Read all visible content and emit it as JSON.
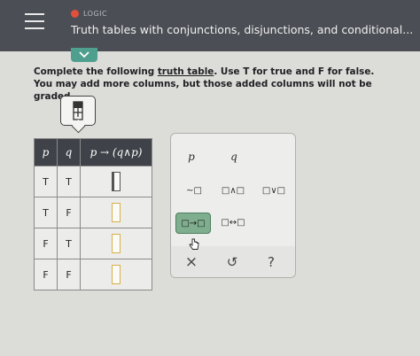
{
  "header": {
    "topic": "LOGIC",
    "title": "Truth tables with conjunctions, disjunctions, and conditional..."
  },
  "instructions": {
    "line1_before": "Complete the following ",
    "line1_link": "truth table",
    "line1_after": ". Use T for true and F for false.",
    "line2": "You may add more columns, but those added columns will not be graded."
  },
  "table": {
    "headers": [
      "p",
      "q",
      "p → (q∧p)"
    ],
    "rows": [
      {
        "p": "T",
        "q": "T"
      },
      {
        "p": "T",
        "q": "F"
      },
      {
        "p": "F",
        "q": "T"
      },
      {
        "p": "F",
        "q": "F"
      }
    ]
  },
  "palette": {
    "var_p": "p",
    "var_q": "q",
    "not": "~□",
    "and": "□∧□",
    "or": "□∨□",
    "implies": "□→□",
    "iff": "□↔□",
    "clear": "×",
    "undo": "↺",
    "help": "?"
  },
  "colors": {
    "header_bg": "#4b4e54",
    "accent": "#4f9f8f",
    "topic_dot": "#e0503c",
    "hover_button": "#7fae8e"
  }
}
